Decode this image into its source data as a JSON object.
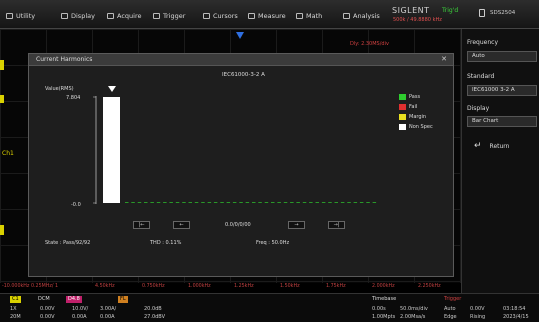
{
  "menu": {
    "items": [
      {
        "label": "Utility",
        "icon": "utility-icon"
      },
      {
        "label": "Display",
        "icon": "display-icon"
      },
      {
        "label": "Acquire",
        "icon": "acquire-icon"
      },
      {
        "label": "Trigger",
        "icon": "trigger-icon"
      },
      {
        "label": "Cursors",
        "icon": "cursors-icon"
      },
      {
        "label": "Measure",
        "icon": "measure-icon"
      },
      {
        "label": "Math",
        "icon": "math-icon"
      },
      {
        "label": "Analysis",
        "icon": "analysis-icon"
      }
    ],
    "brand": "SIGLENT",
    "trig_status": "Trig'd",
    "rate_info": "500k / 49.8880 kHz",
    "system_label": "SDS2504"
  },
  "scope": {
    "delay_readout": "Dly: 2.30MS/div",
    "channel_label": "Ch1"
  },
  "dialog": {
    "title": "Current Harmonics",
    "close_glyph": "✕",
    "standard_heading": "IEC61000-3-2 A",
    "y_axis_label": "Value(RMS)",
    "legend": [
      {
        "label": "Pass",
        "color": "#2ecc2e"
      },
      {
        "label": "Fail",
        "color": "#e03030"
      },
      {
        "label": "Margin",
        "color": "#e8e020"
      },
      {
        "label": "Non Spec",
        "color": "#ffffff"
      }
    ],
    "nav_buttons": [
      "|←",
      "←",
      "→",
      "→|"
    ],
    "harmonic_index": "0.0/0/0/00",
    "state": "State : Pass/92/92",
    "thd": "THD : 0.11%",
    "freq": "Freq : 50.0Hz"
  },
  "chart_data": {
    "type": "bar",
    "ytick_labels": [
      "7.804",
      "-0.0"
    ],
    "ylim": [
      0,
      7.804
    ],
    "fundamental": {
      "value": 7.804,
      "color": "#ffffff"
    },
    "harmonic_count": 40,
    "harmonic_values": [
      0,
      0,
      0,
      0,
      0,
      0,
      0,
      0,
      0,
      0,
      0,
      0,
      0,
      0,
      0,
      0,
      0,
      0,
      0,
      0,
      0,
      0,
      0,
      0,
      0,
      0,
      0,
      0,
      0,
      0,
      0,
      0,
      0,
      0,
      0,
      0,
      0,
      0,
      0,
      0
    ],
    "harmonic_color": "#2ecc2e",
    "grid": false
  },
  "freq_axis": {
    "ticks": [
      "-10.000kHz 0.25MHz/ 1",
      "4.50kHz",
      "0.750kHz",
      "1.000kHz",
      "1.25kHz",
      "1.50kHz",
      "1.75kHz",
      "2.000kHz",
      "2.250kHz"
    ]
  },
  "sidepanel": {
    "frequency_label": "Frequency",
    "frequency_value": "Auto",
    "standard_label": "Standard",
    "standard_value": "IEC61000 3-2 A",
    "display_label": "Display",
    "display_value": "Bar Chart",
    "return_label": "Return"
  },
  "status": {
    "ch1_chip": "C1",
    "dcm": "DCM",
    "fx_chip": "D4.8",
    "math_chip": "FL",
    "cells": [
      [
        "1X",
        "0.00V"
      ],
      [
        "20M",
        "0.00V"
      ],
      [
        "10.0V/",
        "0.00A"
      ],
      [
        "3.00A/",
        "0.00A"
      ],
      [
        "20.0dB",
        "27.0dBV"
      ]
    ],
    "timebase_title": "Timebase",
    "timebase_rows": [
      [
        "0.00s",
        "50.0ms/div"
      ],
      [
        "1.00Mpts",
        "2.00Msa/s"
      ]
    ],
    "trigger_title": "Trigger",
    "trigger_rows": [
      [
        "Auto",
        "0.00V"
      ],
      [
        "Edge",
        "Rising"
      ]
    ],
    "time": "03:18:54",
    "date": "2023/4/15"
  }
}
